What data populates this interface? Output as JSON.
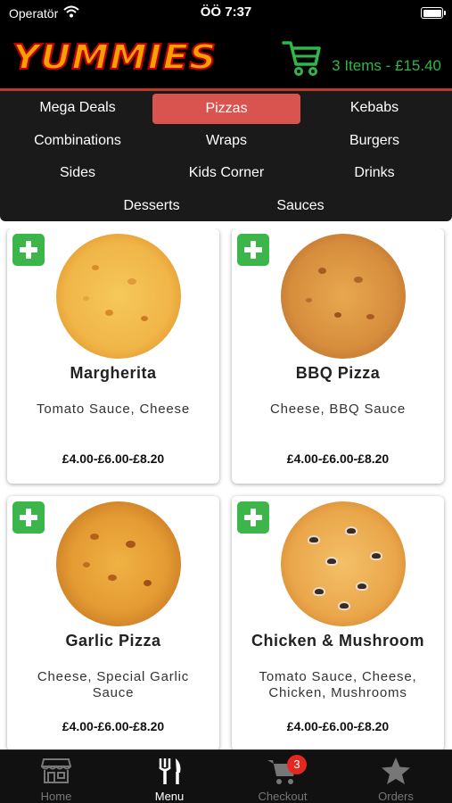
{
  "status_bar": {
    "carrier": "Operatör",
    "time": "ÖÖ 7:37"
  },
  "header": {
    "logo_text": "YUMMIES",
    "cart_summary": "3 Items - £15.40",
    "cart_icon": "shopping-cart-icon",
    "accent_color": "#2fb84a"
  },
  "categories": [
    {
      "label": "Mega Deals",
      "active": false
    },
    {
      "label": "Pizzas",
      "active": true
    },
    {
      "label": "Kebabs",
      "active": false
    },
    {
      "label": "Combinations",
      "active": false
    },
    {
      "label": "Wraps",
      "active": false
    },
    {
      "label": "Burgers",
      "active": false
    },
    {
      "label": "Sides",
      "active": false
    },
    {
      "label": "Kids Corner",
      "active": false
    },
    {
      "label": "Drinks",
      "active": false
    },
    {
      "label": "Desserts",
      "active": false
    },
    {
      "label": "Sauces",
      "active": false
    }
  ],
  "products": [
    {
      "name": "Margherita",
      "description": "Tomato Sauce, Cheese",
      "price": "£4.00-£6.00-£8.20"
    },
    {
      "name": "BBQ Pizza",
      "description": "Cheese, BBQ Sauce",
      "price": "£4.00-£6.00-£8.20"
    },
    {
      "name": "Garlic Pizza",
      "description": "Cheese, Special Garlic Sauce",
      "price": "£4.00-£6.00-£8.20"
    },
    {
      "name": "Chicken & Mushroom",
      "description": "Tomato Sauce, Cheese, Chicken, Mushrooms",
      "price": "£4.00-£6.00-£8.20"
    }
  ],
  "tab_bar": {
    "tabs": [
      {
        "label": "Home",
        "icon": "store-icon",
        "active": false
      },
      {
        "label": "Menu",
        "icon": "fork-knife-icon",
        "active": true
      },
      {
        "label": "Checkout",
        "icon": "cart-icon",
        "active": false,
        "badge": "3"
      },
      {
        "label": "Orders",
        "icon": "star-icon",
        "active": false
      }
    ]
  },
  "colors": {
    "active_category": "#d9534f",
    "add_button": "#3cb54a",
    "badge": "#e5281f"
  }
}
